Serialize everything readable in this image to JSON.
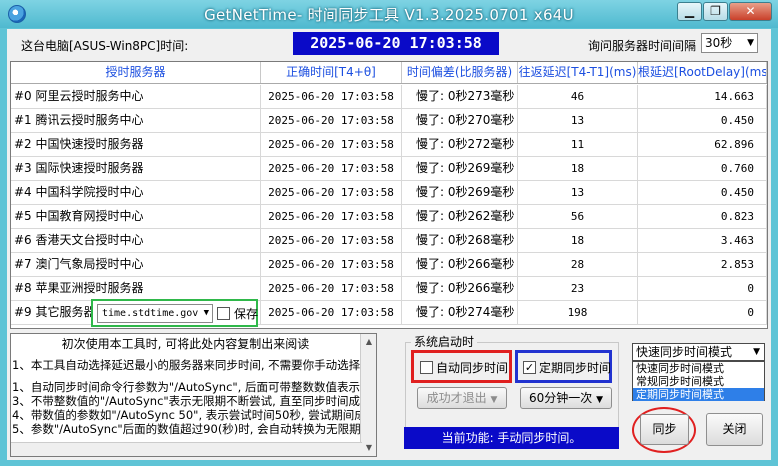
{
  "window": {
    "title": "GetNetTime- 时间同步工具 V1.3.2025.0701 x64U",
    "min_glyph": "▁",
    "max_glyph": "❐",
    "close_glyph": "✕"
  },
  "header": {
    "pc_label": "这台电脑[ASUS-Win8PC]时间:",
    "current_time": "2025-06-20  17:03:58",
    "interval_label": "询问服务器时间间隔",
    "interval_value": "30秒"
  },
  "table": {
    "columns": [
      "授时服务器",
      "正确时间[T4+θ]",
      "时间偏差(比服务器)",
      "往返延迟[T4-T1](ms)",
      "根延迟[RootDelay](ms)"
    ],
    "rows": [
      {
        "server": "#0 阿里云授时服务中心",
        "time": "2025-06-20   17:03:58",
        "offset": "慢了: 0秒273毫秒",
        "rtt": "46",
        "root": "14.663"
      },
      {
        "server": "#1 腾讯云授时服务中心",
        "time": "2025-06-20   17:03:58",
        "offset": "慢了: 0秒270毫秒",
        "rtt": "13",
        "root": "0.450"
      },
      {
        "server": "#2 中国快速授时服务器",
        "time": "2025-06-20   17:03:58",
        "offset": "慢了: 0秒272毫秒",
        "rtt": "11",
        "root": "62.896"
      },
      {
        "server": "#3 国际快速授时服务器",
        "time": "2025-06-20   17:03:58",
        "offset": "慢了: 0秒269毫秒",
        "rtt": "18",
        "root": "0.760"
      },
      {
        "server": "#4 中国科学院授时中心",
        "time": "2025-06-20   17:03:58",
        "offset": "慢了: 0秒269毫秒",
        "rtt": "13",
        "root": "0.450"
      },
      {
        "server": "#5 中国教育网授时中心",
        "time": "2025-06-20   17:03:58",
        "offset": "慢了: 0秒262毫秒",
        "rtt": "56",
        "root": "0.823"
      },
      {
        "server": "#6 香港天文台授时中心",
        "time": "2025-06-20   17:03:58",
        "offset": "慢了: 0秒268毫秒",
        "rtt": "18",
        "root": "3.463"
      },
      {
        "server": "#7 澳门气象局授时中心",
        "time": "2025-06-20   17:03:58",
        "offset": "慢了: 0秒266毫秒",
        "rtt": "28",
        "root": "2.853"
      },
      {
        "server": "#8 苹果亚洲授时服务器",
        "time": "2025-06-20   17:03:58",
        "offset": "慢了: 0秒266毫秒",
        "rtt": "23",
        "root": "0"
      },
      {
        "server": "#9 其它服务器",
        "time": "2025-06-20   17:03:58",
        "offset": "慢了: 0秒274毫秒",
        "rtt": "198",
        "root": "0"
      }
    ],
    "custom_server_value": "time.stdtime.gov",
    "save_label": "保存"
  },
  "notes": {
    "title": "初次使用本工具时, 可将此处内容复制出来阅读",
    "lines": [
      "1、本工具自动选择延迟最小的服务器来同步时间, 不需要你手动选择",
      "1、自动同步时间命令行参数为\"/AutoSync\", 后面可带整数数值表示",
      "3、不带整数值的\"/AutoSync\"表示无限期不断尝试, 直至同步时间成功",
      "4、带数值的参数如\"/AutoSync 50\", 表示尝试时间50秒, 尝试期间成",
      "5、参数\"/AutoSync\"后面的数值超过90(秒)时, 会自动转换为无限期"
    ]
  },
  "startup": {
    "group_title": "系统启动时",
    "auto_sync_label": "自动同步时间",
    "auto_sync_checked": false,
    "periodic_sync_label": "定期同步时间",
    "periodic_sync_checked": true,
    "exit_after_success": "成功才退出",
    "period_value": "60分钟一次",
    "status_text": "当前功能: 手动同步时间。"
  },
  "mode": {
    "selected": "快速同步时间模式",
    "options": [
      "快速同步时间模式",
      "常规同步时间模式",
      "定期同步时间模式"
    ],
    "highlighted_index": 2
  },
  "actions": {
    "sync_label": "同步",
    "close_label": "关闭"
  },
  "colors": {
    "accent_blue": "#0a0ac8",
    "header_text": "#1c4fe0",
    "highlight_red": "#e02020",
    "highlight_green": "#2fb84a",
    "highlight_blue": "#2233d0"
  }
}
